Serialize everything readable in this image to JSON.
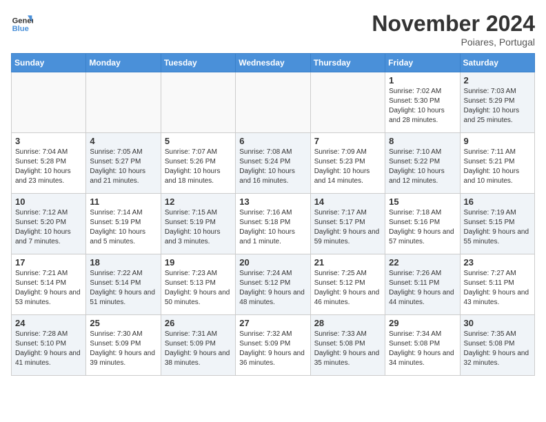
{
  "logo": {
    "line1": "General",
    "line2": "Blue"
  },
  "title": "November 2024",
  "location": "Poiares, Portugal",
  "days_of_week": [
    "Sunday",
    "Monday",
    "Tuesday",
    "Wednesday",
    "Thursday",
    "Friday",
    "Saturday"
  ],
  "weeks": [
    [
      {
        "day": "",
        "info": ""
      },
      {
        "day": "",
        "info": ""
      },
      {
        "day": "",
        "info": ""
      },
      {
        "day": "",
        "info": ""
      },
      {
        "day": "",
        "info": ""
      },
      {
        "day": "1",
        "info": "Sunrise: 7:02 AM\nSunset: 5:30 PM\nDaylight: 10 hours and 28 minutes."
      },
      {
        "day": "2",
        "info": "Sunrise: 7:03 AM\nSunset: 5:29 PM\nDaylight: 10 hours and 25 minutes."
      }
    ],
    [
      {
        "day": "3",
        "info": "Sunrise: 7:04 AM\nSunset: 5:28 PM\nDaylight: 10 hours and 23 minutes."
      },
      {
        "day": "4",
        "info": "Sunrise: 7:05 AM\nSunset: 5:27 PM\nDaylight: 10 hours and 21 minutes."
      },
      {
        "day": "5",
        "info": "Sunrise: 7:07 AM\nSunset: 5:26 PM\nDaylight: 10 hours and 18 minutes."
      },
      {
        "day": "6",
        "info": "Sunrise: 7:08 AM\nSunset: 5:24 PM\nDaylight: 10 hours and 16 minutes."
      },
      {
        "day": "7",
        "info": "Sunrise: 7:09 AM\nSunset: 5:23 PM\nDaylight: 10 hours and 14 minutes."
      },
      {
        "day": "8",
        "info": "Sunrise: 7:10 AM\nSunset: 5:22 PM\nDaylight: 10 hours and 12 minutes."
      },
      {
        "day": "9",
        "info": "Sunrise: 7:11 AM\nSunset: 5:21 PM\nDaylight: 10 hours and 10 minutes."
      }
    ],
    [
      {
        "day": "10",
        "info": "Sunrise: 7:12 AM\nSunset: 5:20 PM\nDaylight: 10 hours and 7 minutes."
      },
      {
        "day": "11",
        "info": "Sunrise: 7:14 AM\nSunset: 5:19 PM\nDaylight: 10 hours and 5 minutes."
      },
      {
        "day": "12",
        "info": "Sunrise: 7:15 AM\nSunset: 5:19 PM\nDaylight: 10 hours and 3 minutes."
      },
      {
        "day": "13",
        "info": "Sunrise: 7:16 AM\nSunset: 5:18 PM\nDaylight: 10 hours and 1 minute."
      },
      {
        "day": "14",
        "info": "Sunrise: 7:17 AM\nSunset: 5:17 PM\nDaylight: 9 hours and 59 minutes."
      },
      {
        "day": "15",
        "info": "Sunrise: 7:18 AM\nSunset: 5:16 PM\nDaylight: 9 hours and 57 minutes."
      },
      {
        "day": "16",
        "info": "Sunrise: 7:19 AM\nSunset: 5:15 PM\nDaylight: 9 hours and 55 minutes."
      }
    ],
    [
      {
        "day": "17",
        "info": "Sunrise: 7:21 AM\nSunset: 5:14 PM\nDaylight: 9 hours and 53 minutes."
      },
      {
        "day": "18",
        "info": "Sunrise: 7:22 AM\nSunset: 5:14 PM\nDaylight: 9 hours and 51 minutes."
      },
      {
        "day": "19",
        "info": "Sunrise: 7:23 AM\nSunset: 5:13 PM\nDaylight: 9 hours and 50 minutes."
      },
      {
        "day": "20",
        "info": "Sunrise: 7:24 AM\nSunset: 5:12 PM\nDaylight: 9 hours and 48 minutes."
      },
      {
        "day": "21",
        "info": "Sunrise: 7:25 AM\nSunset: 5:12 PM\nDaylight: 9 hours and 46 minutes."
      },
      {
        "day": "22",
        "info": "Sunrise: 7:26 AM\nSunset: 5:11 PM\nDaylight: 9 hours and 44 minutes."
      },
      {
        "day": "23",
        "info": "Sunrise: 7:27 AM\nSunset: 5:11 PM\nDaylight: 9 hours and 43 minutes."
      }
    ],
    [
      {
        "day": "24",
        "info": "Sunrise: 7:28 AM\nSunset: 5:10 PM\nDaylight: 9 hours and 41 minutes."
      },
      {
        "day": "25",
        "info": "Sunrise: 7:30 AM\nSunset: 5:09 PM\nDaylight: 9 hours and 39 minutes."
      },
      {
        "day": "26",
        "info": "Sunrise: 7:31 AM\nSunset: 5:09 PM\nDaylight: 9 hours and 38 minutes."
      },
      {
        "day": "27",
        "info": "Sunrise: 7:32 AM\nSunset: 5:09 PM\nDaylight: 9 hours and 36 minutes."
      },
      {
        "day": "28",
        "info": "Sunrise: 7:33 AM\nSunset: 5:08 PM\nDaylight: 9 hours and 35 minutes."
      },
      {
        "day": "29",
        "info": "Sunrise: 7:34 AM\nSunset: 5:08 PM\nDaylight: 9 hours and 34 minutes."
      },
      {
        "day": "30",
        "info": "Sunrise: 7:35 AM\nSunset: 5:08 PM\nDaylight: 9 hours and 32 minutes."
      }
    ]
  ]
}
